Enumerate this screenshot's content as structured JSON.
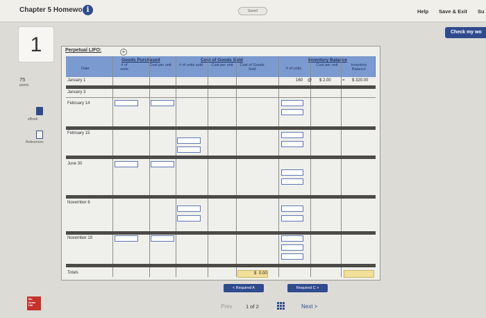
{
  "header": {
    "title": "Chapter 5 Homework",
    "info_glyph": "i",
    "saved": "Saved",
    "help": "Help",
    "save_exit": "Save & Exit",
    "submit": "Su",
    "check": "Check my wo"
  },
  "question": {
    "number": "1",
    "points_value": "75",
    "points_label": "points",
    "ebook": "eBook",
    "references": "References"
  },
  "sheet": {
    "title": "Perpetual LIFO:",
    "groups": {
      "purchased": "Goods Purchased",
      "cogs": "Cost of Goods Sold",
      "inventory": "Inventory Balance"
    },
    "columns": {
      "date": "Date",
      "units_purchased": "# of units",
      "cost_per_unit_purchased": "Cost per unit",
      "units_sold": "# of units sold",
      "cost_per_unit_sold": "Cost per unit",
      "cost_goods_sold": "Cost of Goods Sold",
      "units_inventory": "# of units",
      "cost_per_unit_inventory": "Cost per unit",
      "inventory_balance": "Inventory Balance"
    },
    "dates": [
      "January 1",
      "January 3",
      "February 14",
      "February 15",
      "June 30",
      "November 6",
      "November 19",
      "Totals"
    ],
    "jan1": {
      "units": "160",
      "at": "@",
      "cost": "$ 2.00",
      "eq": "=",
      "balance": "$ 320.00"
    },
    "totals": {
      "dollar": "$",
      "cogs": "0.00"
    }
  },
  "nav": {
    "required_prev": "< Required A",
    "required_next": "Required C >",
    "prev": "Prev",
    "page_current": "1",
    "page_of": "of 2",
    "next": "Next >"
  },
  "brand": {
    "logo_text": "Mc Graw Hill"
  }
}
